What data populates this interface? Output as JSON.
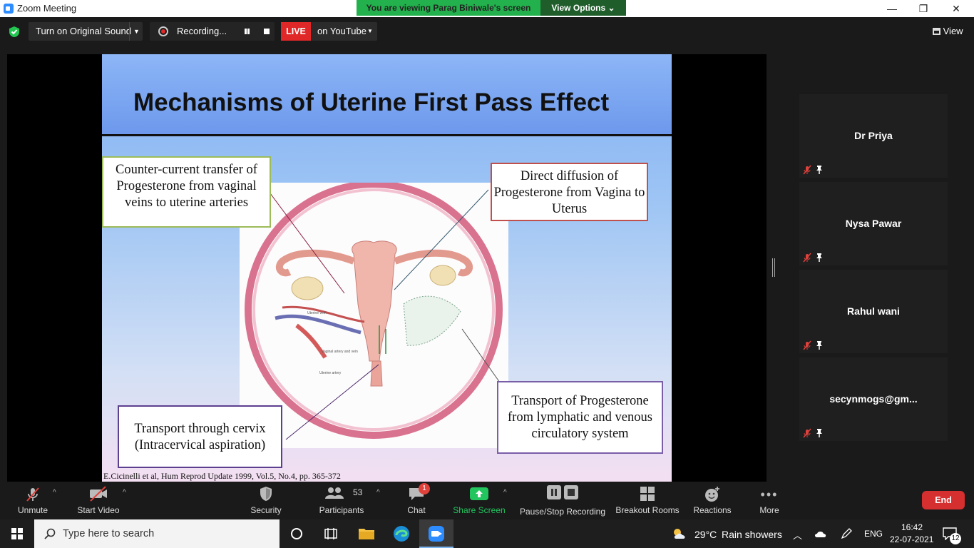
{
  "window": {
    "title": "Zoom Meeting"
  },
  "banner": {
    "viewing": "You are viewing Parag  Biniwale's screen",
    "view_options": "View Options"
  },
  "top": {
    "original_sound": "Turn on Original Sound",
    "recording": "Recording...",
    "live": "LIVE",
    "youtube": "on YouTube",
    "view": "View"
  },
  "slide": {
    "title": "Mechanisms of Uterine First Pass Effect",
    "boxes": {
      "counter_current": "Counter-current transfer of Progesterone from vaginal veins to uterine arteries",
      "direct_diffusion": "Direct diffusion of Progesterone from Vagina to Uterus",
      "cervix": "Transport through cervix (Intracervical aspiration)",
      "lymphatic": "Transport of Progesterone from lymphatic and venous circulatory system"
    },
    "diagram_labels": [
      "Uterine vein",
      "Vaginal artery and vein",
      "Uterine artery"
    ],
    "reference": "E.Cicinelli et al, Hum Reprod Update 1999, Vol.5, No.4, pp. 365-372"
  },
  "participants": [
    {
      "name": "Dr Priya"
    },
    {
      "name": "Nysa Pawar"
    },
    {
      "name": "Rahul wani"
    },
    {
      "name": "secynmogs@gm..."
    }
  ],
  "toolbar": {
    "unmute": "Unmute",
    "start_video": "Start Video",
    "security": "Security",
    "participants": "Participants",
    "participants_count": "53",
    "chat": "Chat",
    "chat_badge": "1",
    "share_screen": "Share Screen",
    "pause_stop": "Pause/Stop Recording",
    "breakout": "Breakout Rooms",
    "reactions": "Reactions",
    "more": "More",
    "end": "End"
  },
  "taskbar": {
    "search_placeholder": "Type here to search",
    "weather_temp": "29°C",
    "weather_text": "Rain showers",
    "lang": "ENG",
    "time": "16:42",
    "date": "22-07-2021",
    "notifications": "12"
  },
  "colors": {
    "live": "#e02828",
    "share": "#22c55e",
    "end": "#d62f2f",
    "muted": "#e0413b"
  }
}
